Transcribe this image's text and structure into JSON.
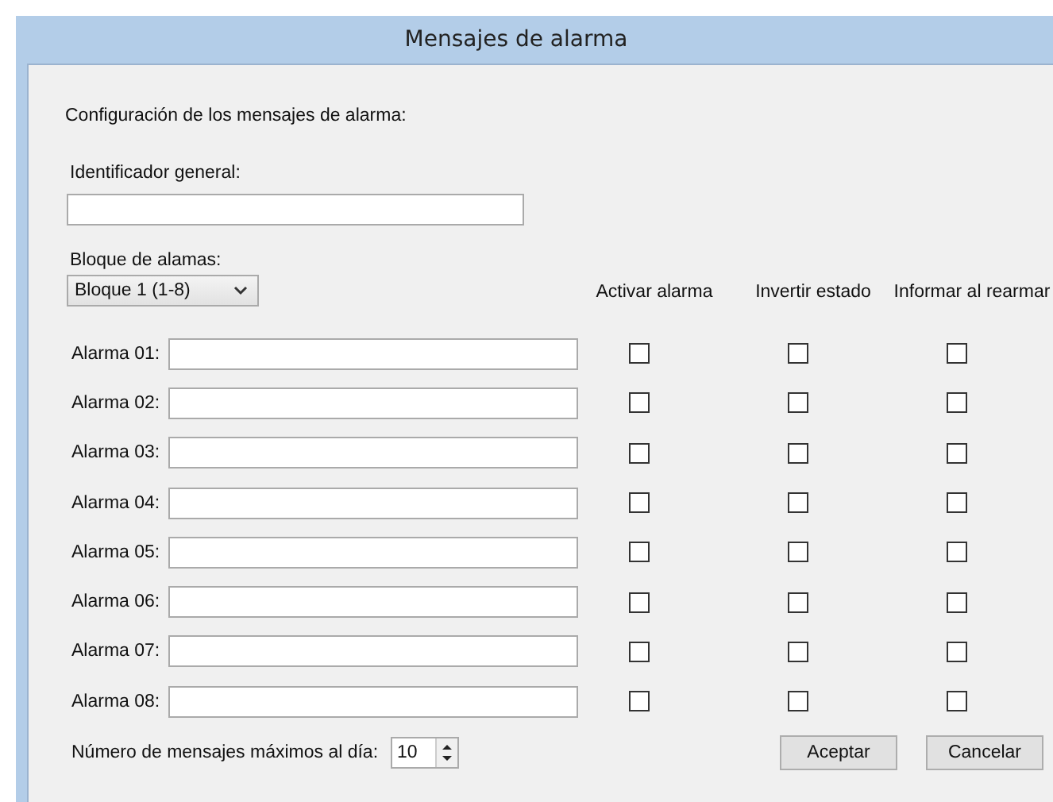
{
  "window": {
    "title": "Mensajes de alarma"
  },
  "heading": "Configuración de los mensajes de alarma:",
  "identifier": {
    "label": "Identificador general:"
  },
  "block": {
    "label": "Bloque de alamas:",
    "value": "Bloque 1 (1-8)"
  },
  "columns": [
    "Activar alarma",
    "Invertir estado",
    "Informar al rearmar"
  ],
  "alarms": [
    {
      "label": "Alarma 01:",
      "activate": false,
      "invert": false,
      "report": false
    },
    {
      "label": "Alarma 02:",
      "activate": false,
      "invert": false,
      "report": false
    },
    {
      "label": "Alarma 03:",
      "activate": false,
      "invert": false,
      "report": false
    },
    {
      "label": "Alarma 04:",
      "activate": false,
      "invert": false,
      "report": false
    },
    {
      "label": "Alarma 05:",
      "activate": false,
      "invert": false,
      "report": false
    },
    {
      "label": "Alarma 06:",
      "activate": false,
      "invert": false,
      "report": false
    },
    {
      "label": "Alarma 07:",
      "activate": false,
      "invert": false,
      "report": false
    },
    {
      "label": "Alarma 08:",
      "activate": false,
      "invert": false,
      "report": false
    }
  ],
  "max_messages": {
    "label": "Número de mensajes máximos al día:",
    "value": "10"
  },
  "buttons": [
    "Aceptar",
    "Cancelar"
  ]
}
